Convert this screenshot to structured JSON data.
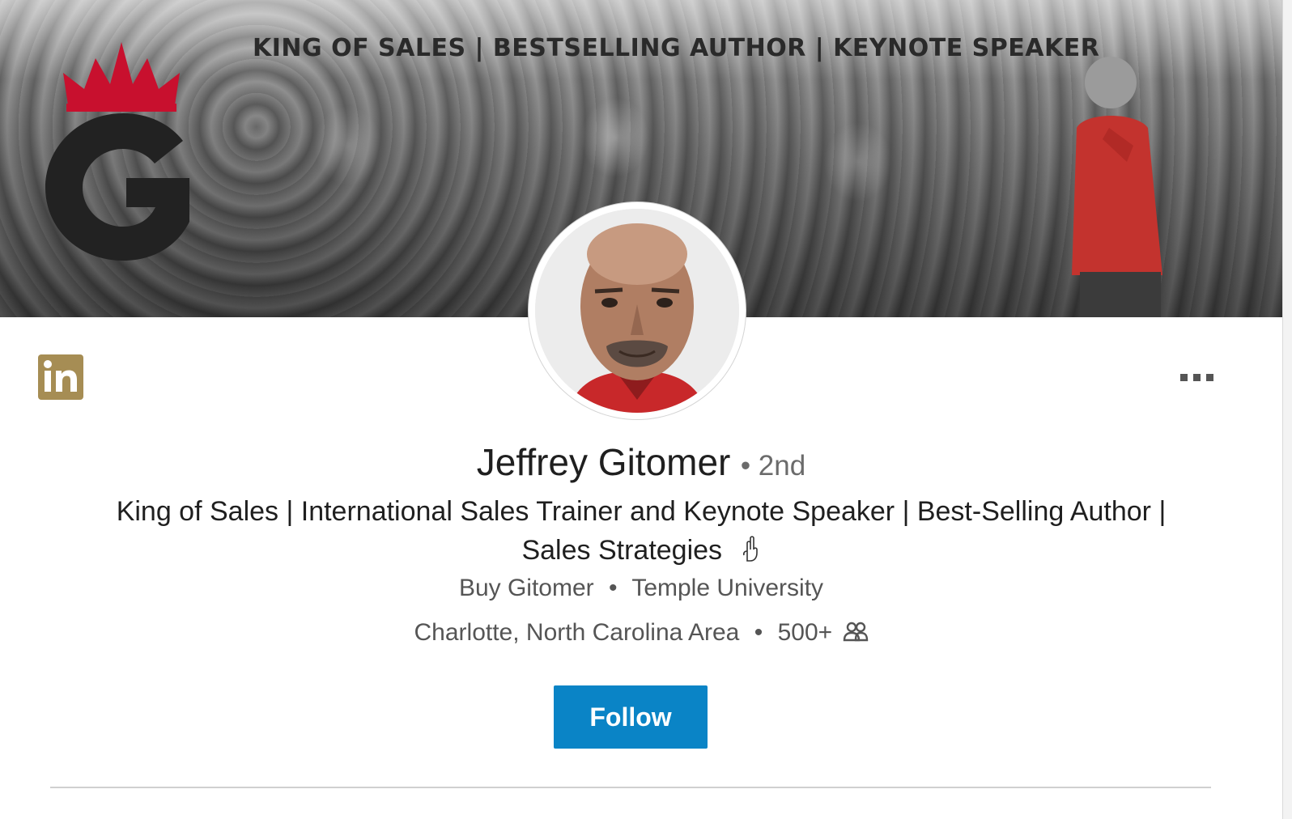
{
  "banner": {
    "tagline": "KING OF SALES  |  BESTSELLING AUTHOR  |  KEYNOTE SPEAKER",
    "logo_icon": "crowned-g-logo",
    "colors": {
      "crown": "#c8102e",
      "logo": "#222222"
    }
  },
  "profile": {
    "name": "Jeffrey Gitomer",
    "degree": "• 2nd",
    "headline": "King of Sales | International Sales Trainer and Keynote Speaker | Best-Selling Author | Sales Strategies",
    "headline_emoji_icon": "backhand-index-pointing-down-icon",
    "company": "Buy Gitomer",
    "education": "Temple University",
    "location": "Charlotte, North Carolina Area",
    "connections": "500+",
    "connections_icon": "people-icon",
    "bullet": "•"
  },
  "actions": {
    "follow_label": "Follow",
    "more_icon": "more-options-icon"
  },
  "colors": {
    "accent": "#0a84c6",
    "linkedin_badge": "#a68d54"
  }
}
